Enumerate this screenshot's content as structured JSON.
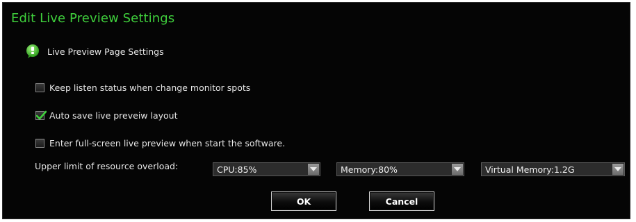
{
  "dialog": {
    "title": "Edit Live Preview Settings",
    "section_label": "Live Preview Page Settings"
  },
  "options": [
    {
      "label": "Keep listen status when change monitor spots",
      "checked": false
    },
    {
      "label": "Auto save live preveiw layout",
      "checked": true
    },
    {
      "label": "Enter full-screen live preview when start the software.",
      "checked": false
    }
  ],
  "resource": {
    "label": "Upper limit of resource overload:",
    "cpu": "CPU:85%",
    "memory": "Memory:80%",
    "virtual_memory": "Virtual Memory:1.2G"
  },
  "buttons": {
    "ok": "OK",
    "cancel": "Cancel"
  },
  "colors": {
    "title": "#3fcf3c",
    "check": "#3fcf3c",
    "background": "#050505"
  },
  "icons": {
    "section": "speech-bubble-icon",
    "dropdown": "chevron-down-icon",
    "checkmark": "checkmark-icon"
  }
}
